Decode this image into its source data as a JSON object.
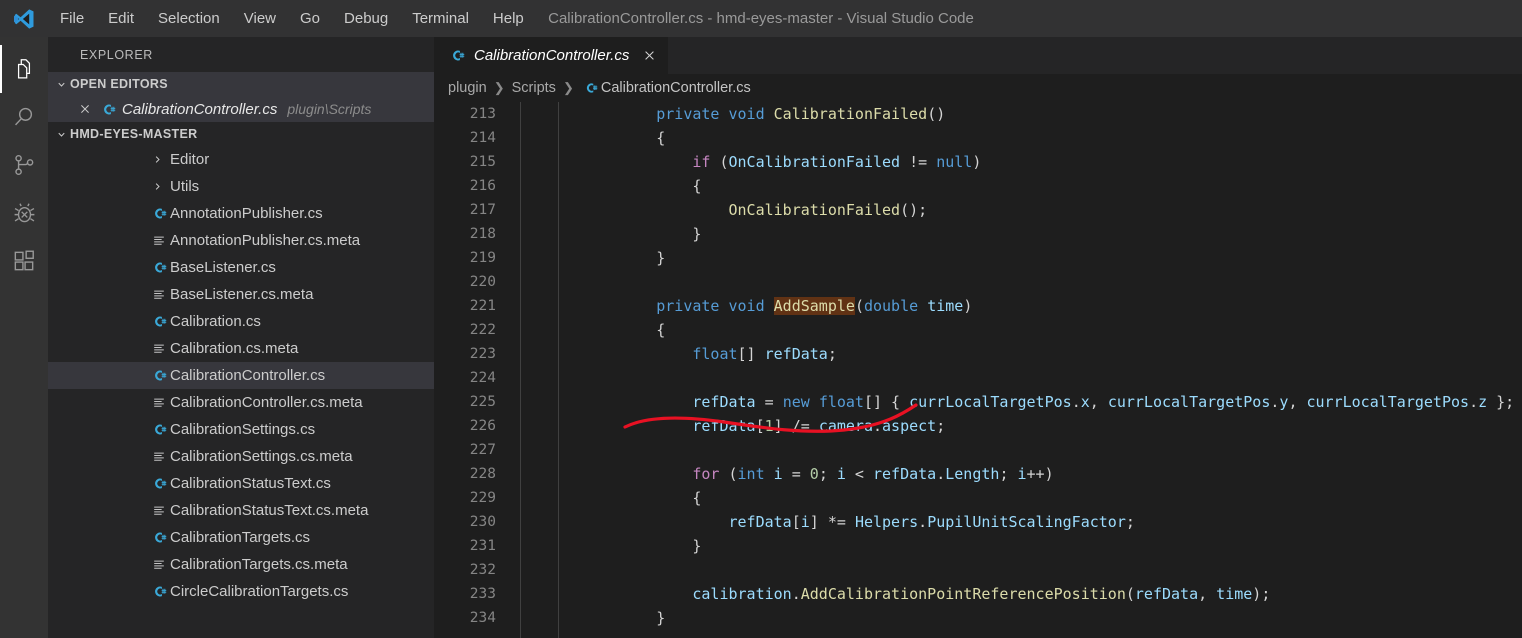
{
  "titlebar": {
    "logo_icon": "vscode-logo-icon",
    "title": "CalibrationController.cs - hmd-eyes-master - Visual Studio Code",
    "menu": [
      {
        "label": "File"
      },
      {
        "label": "Edit"
      },
      {
        "label": "Selection"
      },
      {
        "label": "View"
      },
      {
        "label": "Go"
      },
      {
        "label": "Debug"
      },
      {
        "label": "Terminal"
      },
      {
        "label": "Help"
      }
    ]
  },
  "activitybar": {
    "items": [
      {
        "name": "explorer-icon",
        "active": true
      },
      {
        "name": "search-icon",
        "active": false
      },
      {
        "name": "source-control-icon",
        "active": false
      },
      {
        "name": "debug-icon",
        "active": false
      },
      {
        "name": "extensions-icon",
        "active": false
      }
    ]
  },
  "sidebar": {
    "title": "EXPLORER",
    "open_editors": {
      "header": "OPEN EDITORS",
      "chevron_icon": "chevron-down-icon",
      "items": [
        {
          "close_icon": "close-icon",
          "file_icon": "csharp-file-icon",
          "name": "CalibrationController.cs",
          "path": "plugin\\Scripts"
        }
      ]
    },
    "workspace": {
      "header": "HMD-EYES-MASTER",
      "chevron_icon": "chevron-down-icon",
      "tree": [
        {
          "label": "Editor",
          "type": "folder",
          "icon": "chevron-right-icon",
          "selected": false
        },
        {
          "label": "Utils",
          "type": "folder",
          "icon": "chevron-right-icon",
          "selected": false
        },
        {
          "label": "AnnotationPublisher.cs",
          "type": "cs",
          "icon": "csharp-file-icon",
          "selected": false
        },
        {
          "label": "AnnotationPublisher.cs.meta",
          "type": "meta",
          "icon": "meta-file-icon",
          "selected": false
        },
        {
          "label": "BaseListener.cs",
          "type": "cs",
          "icon": "csharp-file-icon",
          "selected": false
        },
        {
          "label": "BaseListener.cs.meta",
          "type": "meta",
          "icon": "meta-file-icon",
          "selected": false
        },
        {
          "label": "Calibration.cs",
          "type": "cs",
          "icon": "csharp-file-icon",
          "selected": false
        },
        {
          "label": "Calibration.cs.meta",
          "type": "meta",
          "icon": "meta-file-icon",
          "selected": false
        },
        {
          "label": "CalibrationController.cs",
          "type": "cs",
          "icon": "csharp-file-icon",
          "selected": true
        },
        {
          "label": "CalibrationController.cs.meta",
          "type": "meta",
          "icon": "meta-file-icon",
          "selected": false
        },
        {
          "label": "CalibrationSettings.cs",
          "type": "cs",
          "icon": "csharp-file-icon",
          "selected": false
        },
        {
          "label": "CalibrationSettings.cs.meta",
          "type": "meta",
          "icon": "meta-file-icon",
          "selected": false
        },
        {
          "label": "CalibrationStatusText.cs",
          "type": "cs",
          "icon": "csharp-file-icon",
          "selected": false
        },
        {
          "label": "CalibrationStatusText.cs.meta",
          "type": "meta",
          "icon": "meta-file-icon",
          "selected": false
        },
        {
          "label": "CalibrationTargets.cs",
          "type": "cs",
          "icon": "csharp-file-icon",
          "selected": false
        },
        {
          "label": "CalibrationTargets.cs.meta",
          "type": "meta",
          "icon": "meta-file-icon",
          "selected": false
        },
        {
          "label": "CircleCalibrationTargets.cs",
          "type": "cs",
          "icon": "csharp-file-icon",
          "selected": false
        }
      ]
    }
  },
  "editor": {
    "tab": {
      "file_icon": "csharp-file-icon",
      "title": "CalibrationController.cs",
      "close_icon": "close-icon"
    },
    "breadcrumbs": [
      {
        "label": "plugin",
        "icon": null
      },
      {
        "label": "Scripts",
        "icon": null
      },
      {
        "label": "CalibrationController.cs",
        "icon": "csharp-file-icon"
      }
    ],
    "first_line_number": 213,
    "lines": [
      {
        "n": 213,
        "tokens": [
          {
            "t": "        ",
            "c": "pl"
          },
          {
            "t": "private",
            "c": "kw"
          },
          {
            "t": " ",
            "c": "pl"
          },
          {
            "t": "void",
            "c": "kw"
          },
          {
            "t": " ",
            "c": "pl"
          },
          {
            "t": "CalibrationFailed",
            "c": "fn"
          },
          {
            "t": "()",
            "c": "pl"
          }
        ]
      },
      {
        "n": 214,
        "tokens": [
          {
            "t": "        {",
            "c": "pl"
          }
        ]
      },
      {
        "n": 215,
        "tokens": [
          {
            "t": "            ",
            "c": "pl"
          },
          {
            "t": "if",
            "c": "ctl"
          },
          {
            "t": " (",
            "c": "pl"
          },
          {
            "t": "OnCalibrationFailed",
            "c": "var"
          },
          {
            "t": " != ",
            "c": "pl"
          },
          {
            "t": "null",
            "c": "kw"
          },
          {
            "t": ")",
            "c": "pl"
          }
        ]
      },
      {
        "n": 216,
        "tokens": [
          {
            "t": "            {",
            "c": "pl"
          }
        ]
      },
      {
        "n": 217,
        "tokens": [
          {
            "t": "                ",
            "c": "pl"
          },
          {
            "t": "OnCalibrationFailed",
            "c": "fn"
          },
          {
            "t": "();",
            "c": "pl"
          }
        ]
      },
      {
        "n": 218,
        "tokens": [
          {
            "t": "            }",
            "c": "pl"
          }
        ]
      },
      {
        "n": 219,
        "tokens": [
          {
            "t": "        }",
            "c": "pl"
          }
        ]
      },
      {
        "n": 220,
        "tokens": []
      },
      {
        "n": 221,
        "tokens": [
          {
            "t": "        ",
            "c": "pl"
          },
          {
            "t": "private",
            "c": "kw"
          },
          {
            "t": " ",
            "c": "pl"
          },
          {
            "t": "void",
            "c": "kw"
          },
          {
            "t": " ",
            "c": "pl"
          },
          {
            "t": "AddSample",
            "c": "fn hl"
          },
          {
            "t": "(",
            "c": "pl"
          },
          {
            "t": "double",
            "c": "kw"
          },
          {
            "t": " ",
            "c": "pl"
          },
          {
            "t": "time",
            "c": "var"
          },
          {
            "t": ")",
            "c": "pl"
          }
        ]
      },
      {
        "n": 222,
        "tokens": [
          {
            "t": "        {",
            "c": "pl"
          }
        ]
      },
      {
        "n": 223,
        "tokens": [
          {
            "t": "            ",
            "c": "pl"
          },
          {
            "t": "float",
            "c": "kw"
          },
          {
            "t": "[] ",
            "c": "pl"
          },
          {
            "t": "refData",
            "c": "var"
          },
          {
            "t": ";",
            "c": "pl"
          }
        ]
      },
      {
        "n": 224,
        "tokens": []
      },
      {
        "n": 225,
        "tokens": [
          {
            "t": "            ",
            "c": "pl"
          },
          {
            "t": "refData",
            "c": "var"
          },
          {
            "t": " = ",
            "c": "pl"
          },
          {
            "t": "new",
            "c": "kw"
          },
          {
            "t": " ",
            "c": "pl"
          },
          {
            "t": "float",
            "c": "kw"
          },
          {
            "t": "[] { ",
            "c": "pl"
          },
          {
            "t": "currLocalTargetPos",
            "c": "var"
          },
          {
            "t": ".",
            "c": "pl"
          },
          {
            "t": "x",
            "c": "var"
          },
          {
            "t": ", ",
            "c": "pl"
          },
          {
            "t": "currLocalTargetPos",
            "c": "var"
          },
          {
            "t": ".",
            "c": "pl"
          },
          {
            "t": "y",
            "c": "var"
          },
          {
            "t": ", ",
            "c": "pl"
          },
          {
            "t": "currLocalTargetPos",
            "c": "var"
          },
          {
            "t": ".",
            "c": "pl"
          },
          {
            "t": "z",
            "c": "var"
          },
          {
            "t": " };",
            "c": "pl"
          }
        ]
      },
      {
        "n": 226,
        "tokens": [
          {
            "t": "            ",
            "c": "pl"
          },
          {
            "t": "refData",
            "c": "var"
          },
          {
            "t": "[",
            "c": "pl"
          },
          {
            "t": "1",
            "c": "num"
          },
          {
            "t": "] /= ",
            "c": "pl"
          },
          {
            "t": "camera",
            "c": "var"
          },
          {
            "t": ".",
            "c": "pl"
          },
          {
            "t": "aspect",
            "c": "var"
          },
          {
            "t": ";",
            "c": "pl"
          }
        ]
      },
      {
        "n": 227,
        "tokens": []
      },
      {
        "n": 228,
        "tokens": [
          {
            "t": "            ",
            "c": "pl"
          },
          {
            "t": "for",
            "c": "ctl"
          },
          {
            "t": " (",
            "c": "pl"
          },
          {
            "t": "int",
            "c": "kw"
          },
          {
            "t": " ",
            "c": "pl"
          },
          {
            "t": "i",
            "c": "var"
          },
          {
            "t": " = ",
            "c": "pl"
          },
          {
            "t": "0",
            "c": "num"
          },
          {
            "t": "; ",
            "c": "pl"
          },
          {
            "t": "i",
            "c": "var"
          },
          {
            "t": " < ",
            "c": "pl"
          },
          {
            "t": "refData",
            "c": "var"
          },
          {
            "t": ".",
            "c": "pl"
          },
          {
            "t": "Length",
            "c": "var"
          },
          {
            "t": "; ",
            "c": "pl"
          },
          {
            "t": "i",
            "c": "var"
          },
          {
            "t": "++)",
            "c": "pl"
          }
        ]
      },
      {
        "n": 229,
        "tokens": [
          {
            "t": "            {",
            "c": "pl"
          }
        ]
      },
      {
        "n": 230,
        "tokens": [
          {
            "t": "                ",
            "c": "pl"
          },
          {
            "t": "refData",
            "c": "var"
          },
          {
            "t": "[",
            "c": "pl"
          },
          {
            "t": "i",
            "c": "var"
          },
          {
            "t": "] *= ",
            "c": "pl"
          },
          {
            "t": "Helpers",
            "c": "var"
          },
          {
            "t": ".",
            "c": "pl"
          },
          {
            "t": "PupilUnitScalingFactor",
            "c": "var"
          },
          {
            "t": ";",
            "c": "pl"
          }
        ]
      },
      {
        "n": 231,
        "tokens": [
          {
            "t": "            }",
            "c": "pl"
          }
        ]
      },
      {
        "n": 232,
        "tokens": []
      },
      {
        "n": 233,
        "tokens": [
          {
            "t": "            ",
            "c": "pl"
          },
          {
            "t": "calibration",
            "c": "var"
          },
          {
            "t": ".",
            "c": "pl"
          },
          {
            "t": "AddCalibrationPointReferencePosition",
            "c": "fn"
          },
          {
            "t": "(",
            "c": "pl"
          },
          {
            "t": "refData",
            "c": "var"
          },
          {
            "t": ", ",
            "c": "pl"
          },
          {
            "t": "time",
            "c": "var"
          },
          {
            "t": ");",
            "c": "pl"
          }
        ]
      },
      {
        "n": 234,
        "tokens": [
          {
            "t": "        }",
            "c": "pl"
          }
        ]
      }
    ],
    "annotation": {
      "name": "red-underline-annotation",
      "color": "#e81123",
      "target_line": 226
    }
  },
  "colors": {
    "titlebar_bg": "#323233",
    "activitybar_bg": "#333333",
    "sidebar_bg": "#252526",
    "editor_bg": "#1e1e1e",
    "selection_bg": "#37373d",
    "accent_blue": "#569cd6",
    "highlight_box": "#613214",
    "annotation_red": "#e81123"
  }
}
